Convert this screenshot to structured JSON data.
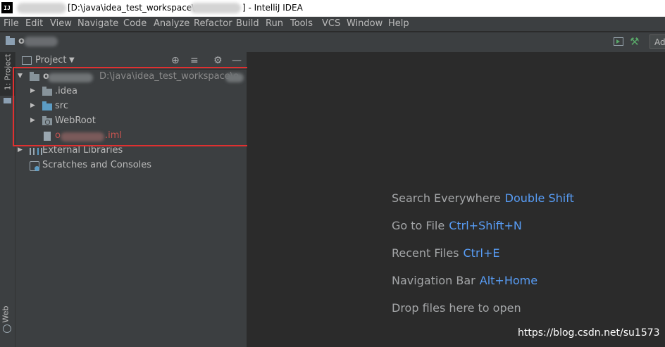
{
  "title_bar": {
    "app_icon": "IJ",
    "title_path": "[D:\\java\\idea_test_workspace\\",
    "title_suffix": "] - IntelliJ IDEA"
  },
  "menu": [
    "File",
    "Edit",
    "View",
    "Navigate",
    "Code",
    "Analyze",
    "Refactor",
    "Build",
    "Run",
    "Tools",
    "VCS",
    "Window",
    "Help"
  ],
  "navbar": {
    "project_initial": "o",
    "field_text": "Ad"
  },
  "left_strip": {
    "project_tab": "1: Project",
    "web_tab": "Web"
  },
  "project_panel": {
    "title": "Project",
    "tree": {
      "root_initial": "o",
      "root_path": "D:\\java\\idea_test_workspace\\o",
      "idea": ".idea",
      "src": "src",
      "webroot": "WebRoot",
      "iml_prefix": "o",
      "iml_suffix": ".iml",
      "external_libraries": "External Libraries",
      "scratches": "Scratches and Consoles"
    }
  },
  "editor_hints": [
    {
      "label": "Search Everywhere",
      "shortcut": "Double Shift"
    },
    {
      "label": "Go to File",
      "shortcut": "Ctrl+Shift+N"
    },
    {
      "label": "Recent Files",
      "shortcut": "Ctrl+E"
    },
    {
      "label": "Navigation Bar",
      "shortcut": "Alt+Home"
    },
    {
      "label": "Drop files here to open",
      "shortcut": ""
    }
  ],
  "watermark": "https://blog.csdn.net/su1573",
  "colors": {
    "shortcut": "#589df6",
    "highlight_box": "#e03030",
    "iml_text": "#c75450"
  },
  "icons": [
    "intellij-app-icon",
    "folder-icon",
    "run-config-icon",
    "hammer-icon",
    "crosshair-icon",
    "collapse-icon",
    "gear-icon",
    "minimize-icon",
    "external-libraries-icon",
    "scratches-icon",
    "web-icon"
  ]
}
